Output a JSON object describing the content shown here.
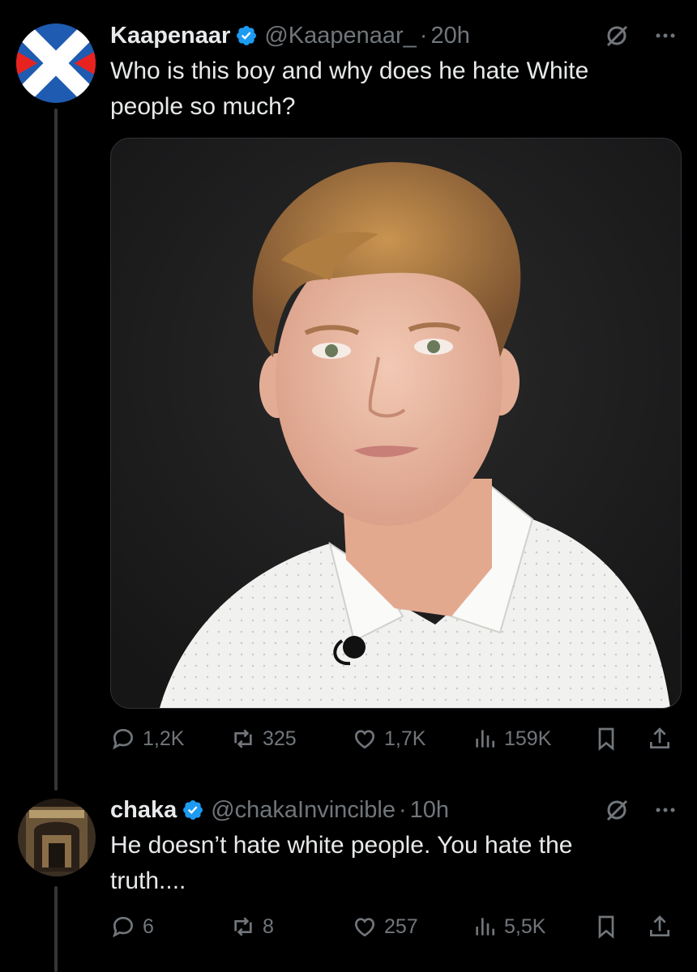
{
  "tweets": [
    {
      "display_name": "Kaapenaar",
      "handle": "@Kaapenaar_",
      "separator": "·",
      "time": "20h",
      "text": "Who is this boy and why does he hate White people so much?",
      "avatar": "scottish-saltire-flag",
      "stats": {
        "replies": "1,2K",
        "reposts": "325",
        "likes": "1,7K",
        "views": "159K"
      }
    },
    {
      "display_name": "chaka",
      "handle": "@chakaInvincible",
      "separator": "·",
      "time": "10h",
      "text": "He doesn’t hate white people. You hate the truth....",
      "avatar": "building-interior-photo",
      "stats": {
        "replies": "6",
        "reposts": "8",
        "likes": "257",
        "views": "5,5K"
      }
    }
  ],
  "colors": {
    "background": "#000000",
    "text_primary": "#e7e9ea",
    "text_secondary": "#71767b",
    "verified_blue": "#1d9bf0",
    "thread_line": "#333639"
  },
  "icons": [
    "verified-badge-icon",
    "grok-icon",
    "more-icon",
    "reply-icon",
    "repost-icon",
    "like-icon",
    "views-icon",
    "bookmark-icon",
    "share-icon"
  ]
}
